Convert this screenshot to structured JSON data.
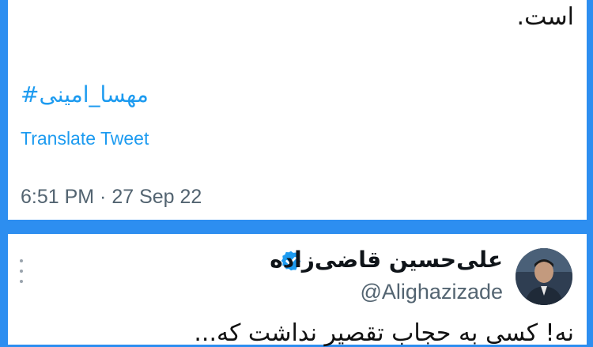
{
  "tweet1": {
    "text_tail": "است.",
    "hashtag": "#مهسا_امینی",
    "translate_label": "Translate Tweet",
    "timestamp": "6:51 PM · 27 Sep 22"
  },
  "tweet2": {
    "author_name": "علی‌حسین قاضی‌زاده",
    "handle": "@Alighazizade",
    "verified_icon": "verified-badge-icon",
    "more_icon": "more-options-icon",
    "text_start": "نه! کسی به حجاب تقصیر نداشت که..."
  },
  "colors": {
    "accent": "#1d9bf0",
    "background": "#2d8ef0",
    "secondary_text": "#536471"
  }
}
